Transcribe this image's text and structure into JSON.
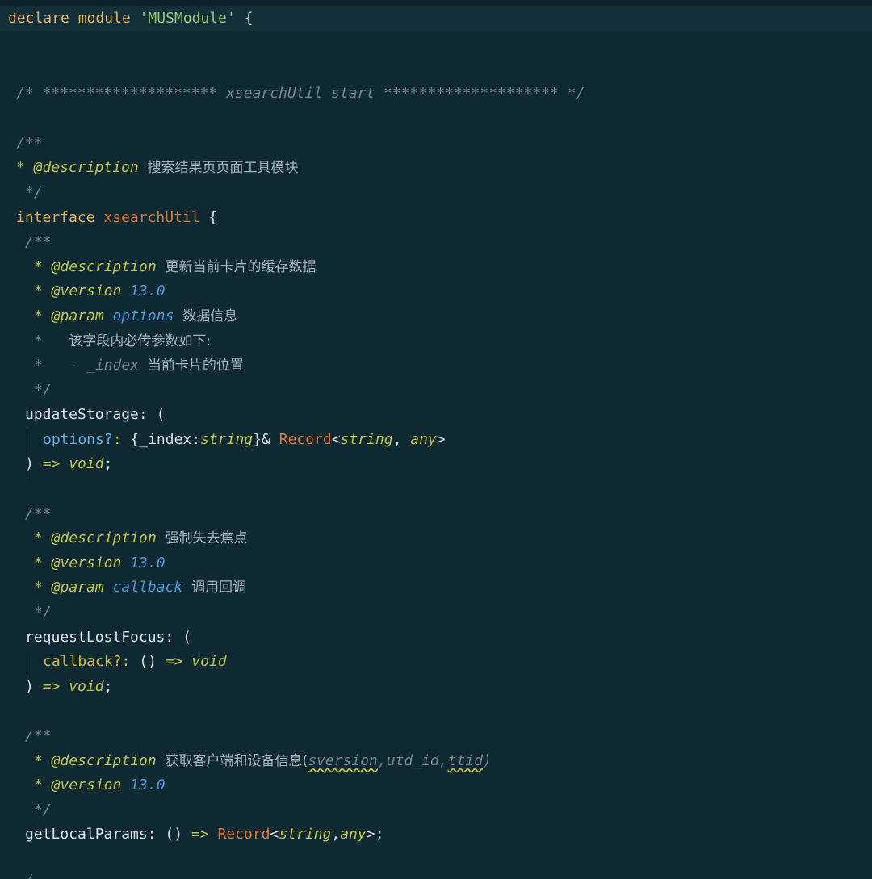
{
  "editor": {
    "lines": {
      "l1": {
        "kw1": "declare",
        "kw2": "module",
        "str": "'MUSModule'",
        "brace": "{"
      },
      "banner": "/* ******************** xsearchUtil start ******************** */",
      "c1_open": "/**",
      "c1_desc_tag": "* @description",
      "c1_desc_text": "搜索结果页页面工具模块",
      "c1_close": "*/",
      "iface_kw": "interface",
      "iface_name": "xsearchUtil",
      "iface_brace": "{",
      "c2_open": "/**",
      "c2_desc_tag": "* @description",
      "c2_desc_text": "更新当前卡片的缓存数据",
      "c2_ver_tag": "* @version",
      "c2_ver_num": "13.0",
      "c2_param_tag": "* @param",
      "c2_param_name": "options",
      "c2_param_text": "数据信息",
      "c2_line4_star": "*",
      "c2_line4_text": "该字段内必传参数如下:",
      "c2_line5_star": "*",
      "c2_line5_code": "- _index",
      "c2_line5_text": "当前卡片的位置",
      "c2_close": "*/",
      "m1_name": "updateStorage",
      "m1_colon_paren": ": (",
      "m1_opt": "options?",
      "m1_colon": ":",
      "m1_obj_open": "{_index:",
      "m1_string": "string",
      "m1_obj_close": "}&",
      "m1_record": "Record",
      "m1_lt": "<",
      "m1_string2": "string",
      "m1_comma": ",",
      "m1_any": "any",
      "m1_gt": ">",
      "m1_close_paren": ")",
      "m1_arrow": "=>",
      "m1_void": "void",
      "m1_semi": ";",
      "c3_open": "/**",
      "c3_desc_tag": "* @description",
      "c3_desc_text": "强制失去焦点",
      "c3_ver_tag": "* @version",
      "c3_ver_num": "13.0",
      "c3_param_tag": "* @param",
      "c3_param_name": "callback",
      "c3_param_text": "调用回调",
      "c3_close": "*/",
      "m2_name": "requestLostFocus",
      "m2_colon_paren": ": (",
      "m2_opt": "callback?",
      "m2_colon": ":",
      "m2_parens": "()",
      "m2_arrow": "=>",
      "m2_void": "void",
      "m2_close_paren": ")",
      "m2_arrow2": "=>",
      "m2_void2": "void",
      "m2_semi": ";",
      "c4_open": "/**",
      "c4_desc_tag": "* @description",
      "c4_desc_text": "获取客户端和设备信息(",
      "c4_sversion": "sversion",
      "c4_mid": ",utd_id,",
      "c4_ttid": "ttid",
      "c4_end": ")",
      "c4_ver_tag": "* @version",
      "c4_ver_num": "13.0",
      "c4_close": "*/",
      "m3_name": "getLocalParams",
      "m3_colon": ":",
      "m3_parens": "()",
      "m3_arrow": "=>",
      "m3_record": "Record",
      "m3_lt": "<",
      "m3_string": "string",
      "m3_comma": ",",
      "m3_any": "any",
      "m3_gt": ">;",
      "last_partial": "/"
    }
  },
  "colors": {
    "background": "#0f2933",
    "current_line": "#132f39",
    "comment": "#6f8791",
    "doc_tag": "#c2c64a",
    "number": "#4d9ede",
    "type_name": "#e0762f",
    "string": "#99c46b"
  }
}
